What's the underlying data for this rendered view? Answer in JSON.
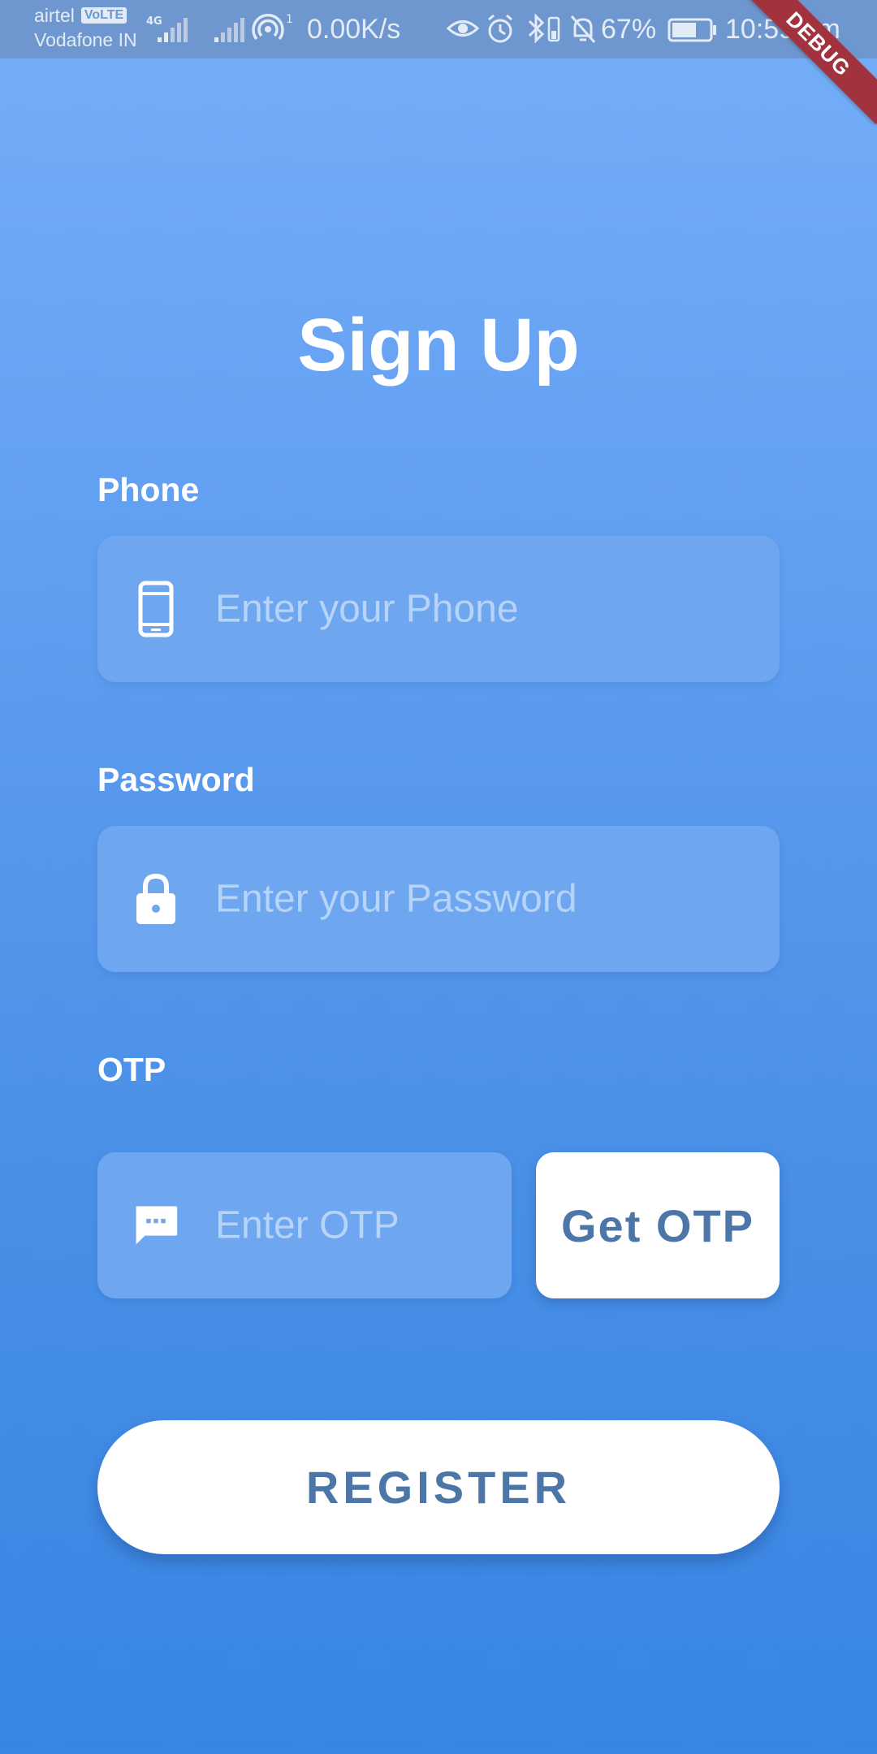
{
  "status_bar": {
    "carrier_primary": "airtel",
    "volte_badge": "VoLTE",
    "carrier_secondary": "Vodafone IN",
    "network_type": "4G",
    "hotspot_count": "1",
    "net_speed": "0.00K/s",
    "battery_percent": "67%",
    "battery_level": 0.67,
    "time": "10:59 am",
    "icons": [
      "signal-icon",
      "signal-icon",
      "hotspot-icon",
      "eye-icon",
      "alarm-icon",
      "bluetooth-icon",
      "bell-off-icon",
      "battery-icon"
    ]
  },
  "debug_banner": "DEBUG",
  "signup": {
    "title": "Sign Up",
    "phone": {
      "label": "Phone",
      "placeholder": "Enter your Phone",
      "icon": "phone-icon"
    },
    "password": {
      "label": "Password",
      "placeholder": "Enter your Password",
      "icon": "lock-icon"
    },
    "otp": {
      "label": "OTP",
      "placeholder": "Enter OTP",
      "icon": "message-icon",
      "button_label": "Get OTP"
    },
    "register_label": "REGISTER"
  },
  "colors": {
    "background_top": "#76aef7",
    "background_bottom": "#3886e4",
    "field_bg": "#6ea6ef",
    "button_text": "#4c76a7",
    "debug_ribbon": "#a1323e"
  }
}
